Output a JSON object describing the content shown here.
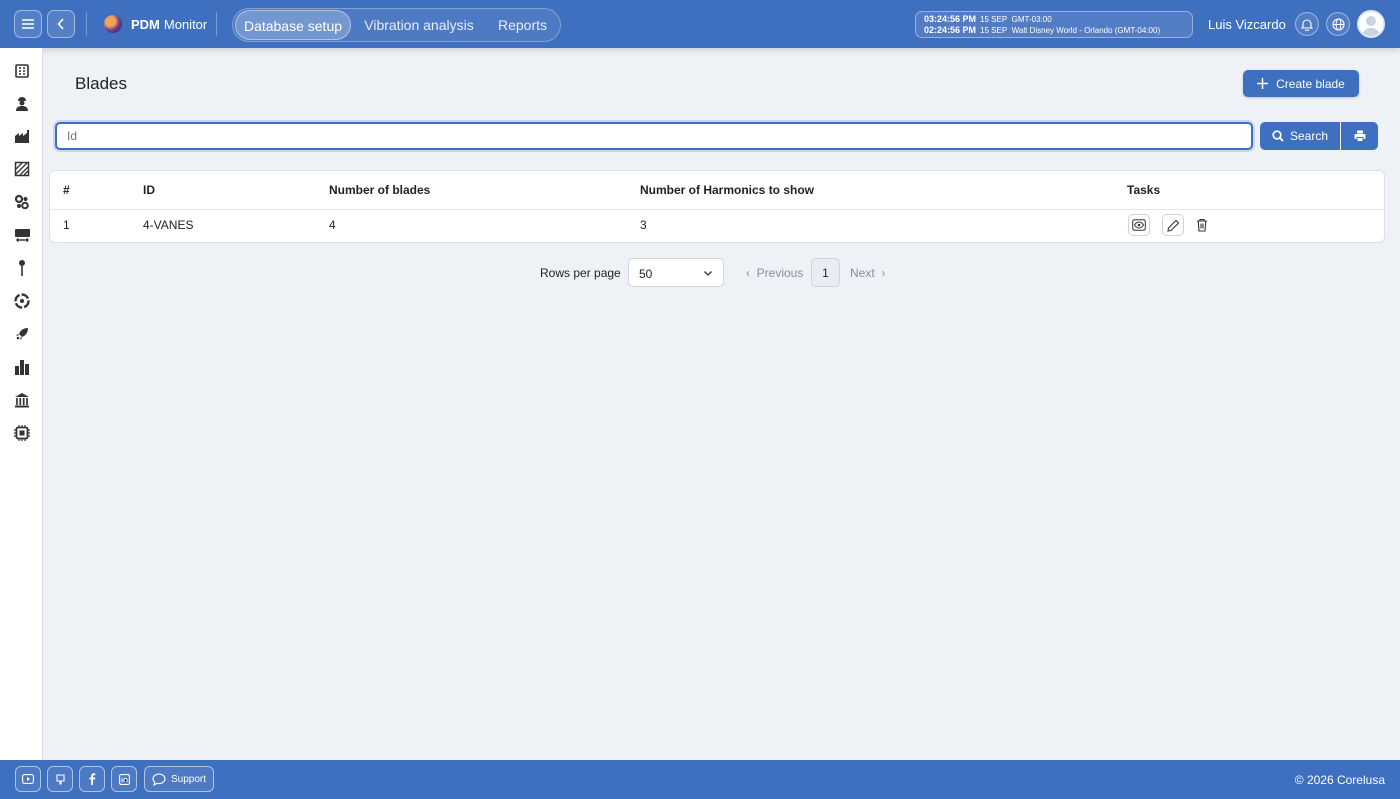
{
  "topbar": {
    "brand_bold": "PDM",
    "brand_rest": "Monitor",
    "tabs": [
      {
        "label": "Database setup",
        "active": true
      },
      {
        "label": "Vibration analysis",
        "active": false
      },
      {
        "label": "Reports",
        "active": false
      }
    ],
    "clock": [
      {
        "time": "03:24:56 PM",
        "date": "15 SEP",
        "zone": "GMT-03:00"
      },
      {
        "time": "02:24:56 PM",
        "date": "15 SEP",
        "zone": "Walt Disney World - Orlando (GMT-04:00)"
      }
    ],
    "user_name": "Luis Vizcardo"
  },
  "sidebar": {
    "icons": [
      "building-icon",
      "worker-icon",
      "factory-icon",
      "panel-icon",
      "gears-icon",
      "conveyor-icon",
      "pin-icon",
      "fan-icon",
      "rocket-icon",
      "bar-chart-icon",
      "bank-icon",
      "chip-icon"
    ]
  },
  "page": {
    "title": "Blades",
    "create_label": "Create blade",
    "search_placeholder": "Id",
    "search_label": "Search"
  },
  "table": {
    "headers": [
      "#",
      "ID",
      "Number of blades",
      "Number of Harmonics to show",
      "Tasks"
    ],
    "rows": [
      {
        "index": "1",
        "id": "4-VANES",
        "blades": "4",
        "harmonics": "3"
      }
    ]
  },
  "pager": {
    "rows_label": "Rows per page",
    "rows_value": "50",
    "prev_label": "Previous",
    "page": "1",
    "next_label": "Next"
  },
  "footer": {
    "support_label": "Support",
    "copyright": "© 2026 Corelusa"
  },
  "colors": {
    "brand_blue": "#3f6fbf",
    "background": "#eef1f5"
  }
}
